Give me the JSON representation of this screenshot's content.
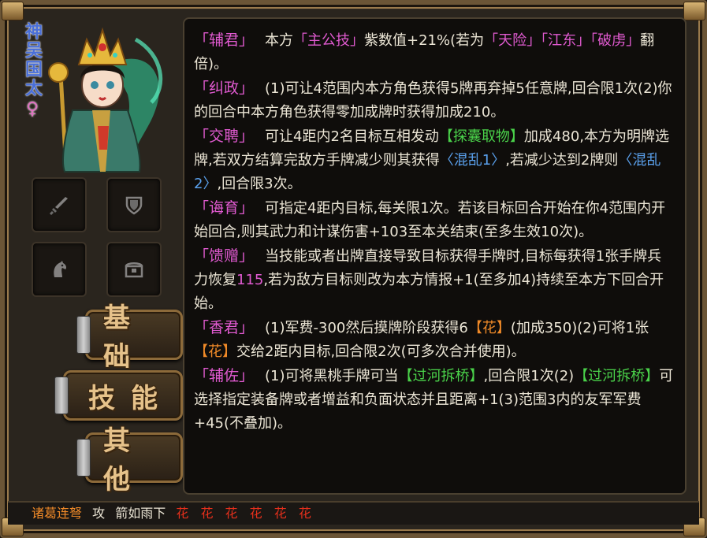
{
  "character": {
    "name": "神吴国太",
    "gender_symbol": "♀"
  },
  "equipment_slots": [
    "weapon",
    "armor",
    "horse",
    "treasure"
  ],
  "tabs": [
    {
      "label": "基础"
    },
    {
      "label": "技能"
    },
    {
      "label": "其他"
    }
  ],
  "skills": [
    {
      "name": "「辅君」",
      "parts": [
        {
          "t": "本方"
        },
        {
          "t": "「主公技」",
          "c": "pink"
        },
        {
          "t": "紫数值+21%(若为"
        },
        {
          "t": "「天险」",
          "c": "pink"
        },
        {
          "t": "「江东」",
          "c": "pink"
        },
        {
          "t": "「破虏」",
          "c": "pink"
        },
        {
          "t": "翻倍)。"
        }
      ]
    },
    {
      "name": "「纠政」",
      "parts": [
        {
          "t": "(1)可让4范围内本方角色获得5牌再弃掉5任意牌,回合限1次(2)你的回合中本方角色获得零加成牌时获得加成210。"
        }
      ]
    },
    {
      "name": "「交聘」",
      "parts": [
        {
          "t": "可让4距内2名目标互相发动"
        },
        {
          "t": "【探囊取物】",
          "c": "green"
        },
        {
          "t": "加成480,本方为明牌选牌,若双方结算完敌方手牌减少则其获得"
        },
        {
          "t": "〈混乱1〉",
          "c": "blue"
        },
        {
          "t": ",若减少达到2牌则"
        },
        {
          "t": "〈混乱2〉",
          "c": "blue"
        },
        {
          "t": ",回合限3次。"
        }
      ]
    },
    {
      "name": "「诲育」",
      "parts": [
        {
          "t": "可指定4距内目标,每关限1次。若该目标回合开始在你4范围内开始回合,则其武力和计谋伤害+103至本关结束(至多生效10次)。"
        }
      ]
    },
    {
      "name": "「馈赠」",
      "parts": [
        {
          "t": "当技能或者出牌直接导致目标获得手牌时,目标每获得1张手牌兵力恢复"
        },
        {
          "t": "115",
          "c": "pink"
        },
        {
          "t": ",若为敌方目标则改为本方情报+1(至多加4)持续至本方下回合开始。"
        }
      ]
    },
    {
      "name": "「香君」",
      "parts": [
        {
          "t": "(1)军费-300然后摸牌阶段获得6"
        },
        {
          "t": "【花】",
          "c": "orange"
        },
        {
          "t": "(加成350)(2)可将1张"
        },
        {
          "t": "【花】",
          "c": "orange"
        },
        {
          "t": "交给2距内目标,回合限2次(可多次合并使用)。"
        }
      ]
    },
    {
      "name": "「辅佐」",
      "parts": [
        {
          "t": "(1)可将黑桃手牌可当"
        },
        {
          "t": "【过河拆桥】",
          "c": "green"
        },
        {
          "t": ",回合限1次(2)"
        },
        {
          "t": "【过河拆桥】",
          "c": "green"
        },
        {
          "t": "可选择指定装备牌或者增益和负面状态并且距离+1(3)范围3内的友军军费+45(不叠加)。"
        }
      ]
    }
  ],
  "bottom_bar": {
    "weapon": "诸葛连弩",
    "items": [
      "攻",
      "箭如雨下"
    ],
    "flowers": [
      "花",
      "花",
      "花",
      "花",
      "花",
      "花"
    ]
  },
  "colors": {
    "skill_name": "#e05ad0",
    "keyword_green": "#4ad24a",
    "keyword_blue": "#5aa0ec",
    "keyword_orange": "#f08a28",
    "flower_red": "#e8301c",
    "frame_gold": "#9a7a4c"
  }
}
